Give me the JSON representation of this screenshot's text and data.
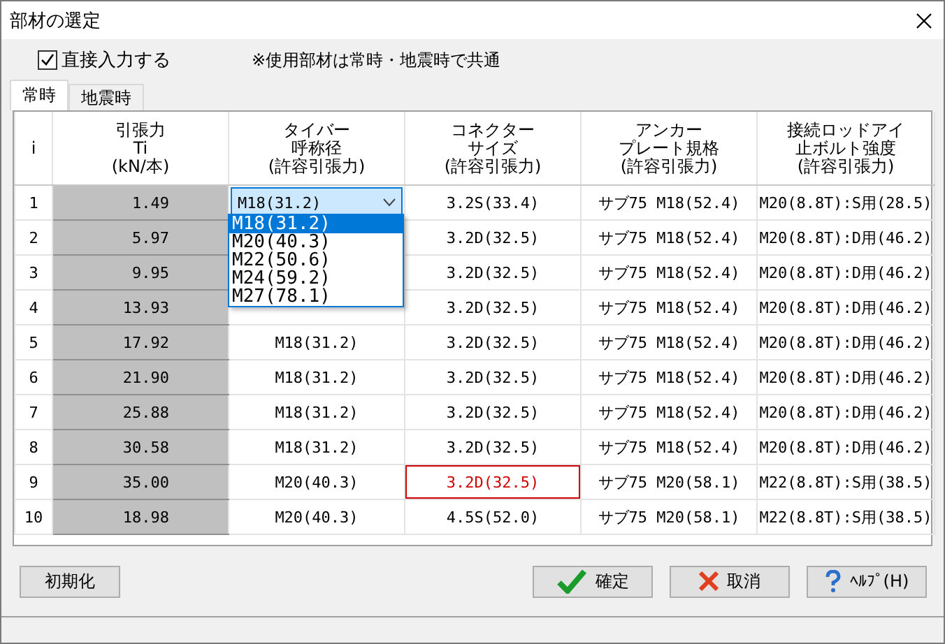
{
  "window": {
    "title": "部材の選定"
  },
  "direct_input": {
    "label": "直接入力する",
    "checked": true
  },
  "note": "※使用部材は常時・地震時で共通",
  "tabs": [
    {
      "label": "常時",
      "selected": true
    },
    {
      "label": "地震時",
      "selected": false
    }
  ],
  "table": {
    "columns": [
      {
        "lines": [
          "i"
        ]
      },
      {
        "lines": [
          "引張力",
          "Ti",
          "(kN/本)"
        ]
      },
      {
        "lines": [
          "タイバー",
          "呼称径",
          "(許容引張力)"
        ]
      },
      {
        "lines": [
          "コネクター",
          "サイズ",
          "(許容引張力)"
        ]
      },
      {
        "lines": [
          "アンカー",
          "プレート規格",
          "(許容引張力)"
        ]
      },
      {
        "lines": [
          "接続ロッドアイ",
          "止ボルト強度",
          "(許容引張力)"
        ]
      }
    ],
    "rows": [
      {
        "i": "1",
        "tension": "1.49",
        "tie": "M18(31.2)",
        "tie_combo": true,
        "connector": "3.2S(33.4)",
        "connector_error": false,
        "anchor": "サブ75 M18(52.4)",
        "rod": "M20(8.8T):S用(28.5)"
      },
      {
        "i": "2",
        "tension": "5.97",
        "connector": "3.2D(32.5)",
        "connector_error": false,
        "anchor": "サブ75 M18(52.4)",
        "rod": "M20(8.8T):D用(46.2)"
      },
      {
        "i": "3",
        "tension": "9.95",
        "connector": "3.2D(32.5)",
        "connector_error": false,
        "anchor": "サブ75 M18(52.4)",
        "rod": "M20(8.8T):D用(46.2)"
      },
      {
        "i": "4",
        "tension": "13.93",
        "connector": "3.2D(32.5)",
        "connector_error": false,
        "anchor": "サブ75 M18(52.4)",
        "rod": "M20(8.8T):D用(46.2)"
      },
      {
        "i": "5",
        "tension": "17.92",
        "tie": "M18(31.2)",
        "tie_combo": false,
        "connector": "3.2D(32.5)",
        "connector_error": false,
        "anchor": "サブ75 M18(52.4)",
        "rod": "M20(8.8T):D用(46.2)"
      },
      {
        "i": "6",
        "tension": "21.90",
        "tie": "M18(31.2)",
        "tie_combo": false,
        "connector": "3.2D(32.5)",
        "connector_error": false,
        "anchor": "サブ75 M18(52.4)",
        "rod": "M20(8.8T):D用(46.2)"
      },
      {
        "i": "7",
        "tension": "25.88",
        "tie": "M18(31.2)",
        "tie_combo": false,
        "connector": "3.2D(32.5)",
        "connector_error": false,
        "anchor": "サブ75 M18(52.4)",
        "rod": "M20(8.8T):D用(46.2)"
      },
      {
        "i": "8",
        "tension": "30.58",
        "tie": "M18(31.2)",
        "tie_combo": false,
        "connector": "3.2D(32.5)",
        "connector_error": false,
        "anchor": "サブ75 M18(52.4)",
        "rod": "M20(8.8T):D用(46.2)"
      },
      {
        "i": "9",
        "tension": "35.00",
        "tie": "M20(40.3)",
        "tie_combo": false,
        "connector": "3.2D(32.5)",
        "connector_error": true,
        "anchor": "サブ75 M20(58.1)",
        "rod": "M22(8.8T):S用(38.5)"
      },
      {
        "i": "10",
        "tension": "18.98",
        "tie": "M20(40.3)",
        "tie_combo": false,
        "connector": "4.5S(52.0)",
        "connector_error": false,
        "anchor": "サブ75 M20(58.1)",
        "rod": "M22(8.8T):S用(38.5)"
      }
    ]
  },
  "dropdown": {
    "options": [
      {
        "label": "M18(31.2)",
        "selected": true
      },
      {
        "label": "M20(40.3)",
        "selected": false
      },
      {
        "label": "M22(50.6)",
        "selected": false
      },
      {
        "label": "M24(59.2)",
        "selected": false
      },
      {
        "label": "M27(78.1)",
        "selected": false
      }
    ]
  },
  "buttons": [
    {
      "label": "初期化",
      "kind": "plain"
    },
    {
      "label": "確定",
      "kind": "ok"
    },
    {
      "label": "取消",
      "kind": "cancel"
    },
    {
      "label": "ﾍﾙﾌﾟ(H)",
      "kind": "help"
    }
  ]
}
